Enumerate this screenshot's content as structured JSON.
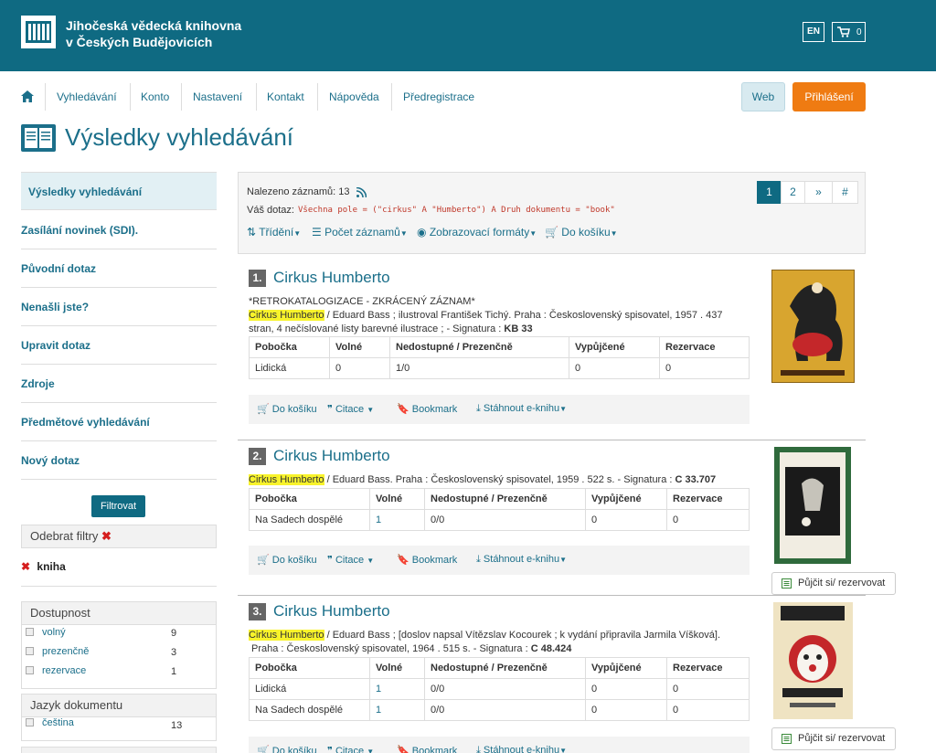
{
  "header": {
    "logo_line1": "Jihočeská vědecká knihovna",
    "logo_line2": "v Českých Budějovicích",
    "lang": "EN",
    "cart_count": "0"
  },
  "nav": {
    "items": [
      "Vyhledávání",
      "Konto",
      "Nastavení",
      "Kontakt",
      "Nápověda",
      "Předregistrace"
    ],
    "web": "Web",
    "login": "Přihlášení"
  },
  "page_title": "Výsledky vyhledávání",
  "sidebar": {
    "items": [
      "Výsledky vyhledávání",
      "Zasílání novinek (SDI).",
      "Původní dotaz",
      "Nenašli jste?",
      "Upravit dotaz",
      "Zdroje",
      "Předmětové vyhledávání",
      "Nový dotaz"
    ],
    "filter_button": "Filtrovat",
    "remove_filters": "Odebrat filtry",
    "active_filter": "kniha",
    "availability": {
      "title": "Dostupnost",
      "rows": [
        {
          "label": "volný",
          "count": "9"
        },
        {
          "label": "prezenčně",
          "count": "3"
        },
        {
          "label": "rezervace",
          "count": "1"
        }
      ]
    },
    "language": {
      "title": "Jazyk dokumentu",
      "rows": [
        {
          "label": "čeština",
          "count": "13"
        }
      ]
    }
  },
  "results": {
    "found_label": "Nalezeno záznamů: 13",
    "query_label": "Váš dotaz:",
    "query": "Všechna pole = (\"cirkus\" A \"Humberto\") A Druh dokumentu = \"book\"",
    "tools": [
      "Třídění",
      "Počet záznamů",
      "Zobrazovací formáty",
      "Do košíku"
    ],
    "pages": [
      "1",
      "2",
      "»",
      "#"
    ]
  },
  "records": [
    {
      "num": "1.",
      "title": "Cirkus Humberto",
      "note": "*RETROKATALOGIZACE - ZKRÁCENÝ ZÁZNAM*",
      "hl": "Cirkus Humberto",
      "desc1": " / Eduard Bass ; ilustroval František Tichý.   Praha : Československý spisovatel, 1957 . 437",
      "desc2": "stran, 4 nečíslované listy barevné ilustrace ; - Signatura : ",
      "signature": "KB 33",
      "headers": [
        "Pobočka",
        "Volné",
        "Nedostupné / Prezenčně",
        "Vypůjčené",
        "Rezervace"
      ],
      "rows": [
        [
          "Lidická",
          "0",
          "1/0",
          "0",
          "0"
        ]
      ]
    },
    {
      "num": "2.",
      "title": "Cirkus Humberto",
      "hl": "Cirkus Humberto",
      "desc1": " / Eduard Bass.   Praha : Československý spisovatel, 1959 . 522 s. - Signatura : ",
      "signature": "C 33.707",
      "headers": [
        "Pobočka",
        "Volné",
        "Nedostupné / Prezenčně",
        "Vypůjčené",
        "Rezervace"
      ],
      "rows": [
        [
          "Na Sadech dospělé",
          "1",
          "0/0",
          "0",
          "0"
        ]
      ],
      "borrow": "Půjčit si/ rezervovat"
    },
    {
      "num": "3.",
      "title": "Cirkus Humberto",
      "hl": "Cirkus Humberto",
      "desc1": " / Eduard Bass ; [doslov napsal Vítězslav Kocourek ; k vydání připravila Jarmila Víšková].",
      "desc2": "Praha : Československý spisovatel, 1964 . 515 s. - Signatura : ",
      "signature": "C 48.424",
      "headers": [
        "Pobočka",
        "Volné",
        "Nedostupné / Prezenčně",
        "Vypůjčené",
        "Rezervace"
      ],
      "rows": [
        [
          "Lidická",
          "1",
          "0/0",
          "0",
          "0"
        ],
        [
          "Na Sadech dospělé",
          "1",
          "0/0",
          "0",
          "0"
        ]
      ],
      "borrow": "Půjčit si/ rezervovat"
    }
  ],
  "actions": {
    "cart": "Do košíku",
    "cite": "Citace",
    "bookmark": "Bookmark",
    "ebook": "Stáhnout e-knihu"
  },
  "colors": {
    "header": "#0f6a82",
    "link": "#1b6f8a",
    "login": "#ef7b12",
    "highlight": "#f8f32b"
  }
}
